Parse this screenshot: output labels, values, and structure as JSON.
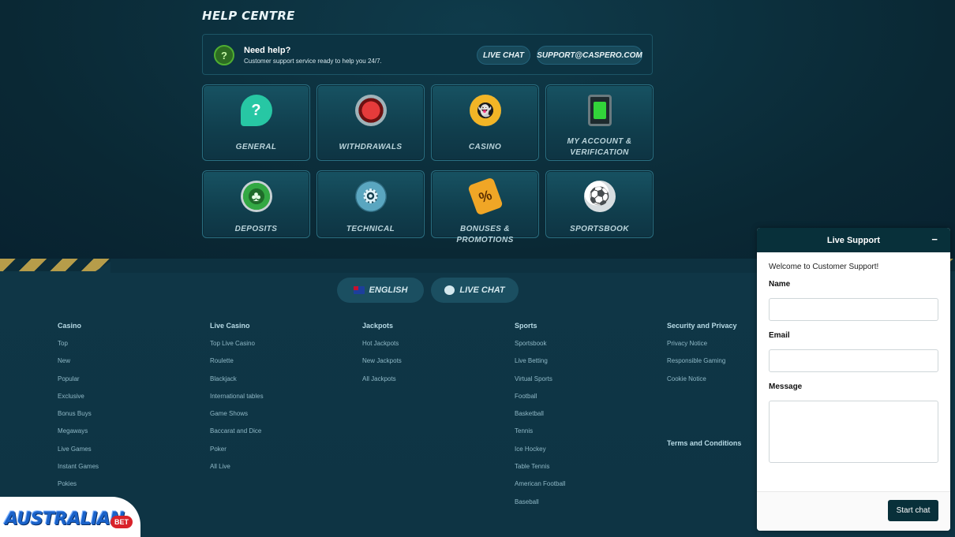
{
  "help": {
    "title": "HELP CENTRE",
    "need_help": "Need help?",
    "subtitle": "Customer support service ready to help you 24/7.",
    "live_chat": "LIVE CHAT",
    "email": "SUPPORT@CASPERO.COM"
  },
  "categories": [
    {
      "label": "GENERAL",
      "icon": "question-bubble-icon"
    },
    {
      "label": "WITHDRAWALS",
      "icon": "red-button-icon"
    },
    {
      "label": "CASINO",
      "icon": "casino-chip-icon"
    },
    {
      "label": "MY ACCOUNT & VERIFICATION",
      "icon": "account-tablet-icon"
    },
    {
      "label": "DEPOSITS",
      "icon": "clover-coin-icon"
    },
    {
      "label": "TECHNICAL",
      "icon": "gear-icon"
    },
    {
      "label": "BONUSES & PROMOTIONS",
      "icon": "percent-tag-icon"
    },
    {
      "label": "SPORTSBOOK",
      "icon": "soccer-ball-icon"
    }
  ],
  "footer_buttons": {
    "language": "ENGLISH",
    "live_chat": "LIVE CHAT"
  },
  "footer": {
    "columns": [
      {
        "heading": "Casino",
        "items": [
          "Top",
          "New",
          "Popular",
          "Exclusive",
          "Bonus Buys",
          "Megaways",
          "Live Games",
          "Instant Games",
          "Pokies"
        ]
      },
      {
        "heading": "Live Casino",
        "items": [
          "Top Live Casino",
          "Roulette",
          "Blackjack",
          "International tables",
          "Game Shows",
          "Baccarat and Dice",
          "Poker",
          "All Live"
        ]
      },
      {
        "heading": "Jackpots",
        "items": [
          "Hot Jackpots",
          "New Jackpots",
          "All Jackpots"
        ]
      },
      {
        "heading": "Sports",
        "items": [
          "Sportsbook",
          "Live Betting",
          "Virtual Sports",
          "Football",
          "Basketball",
          "Tennis",
          "Ice Hockey",
          "Table Tennis",
          "American Football",
          "Baseball"
        ]
      },
      {
        "heading": "Security and Privacy",
        "items": [
          "Privacy Notice",
          "Responsible Gaming",
          "Cookie Notice"
        ]
      }
    ],
    "terms": "Terms and Conditions"
  },
  "chat": {
    "title": "Live Support",
    "minimize": "−",
    "welcome": "Welcome to Customer Support!",
    "name_label": "Name",
    "email_label": "Email",
    "message_label": "Message",
    "start_button": "Start chat"
  },
  "logo": {
    "text": "AUSTRALIAN",
    "badge": "BET"
  },
  "colors": {
    "background": "#0d3140",
    "tile": "#175262",
    "chat_header": "#08303a",
    "hazard": "#c9a84a"
  }
}
